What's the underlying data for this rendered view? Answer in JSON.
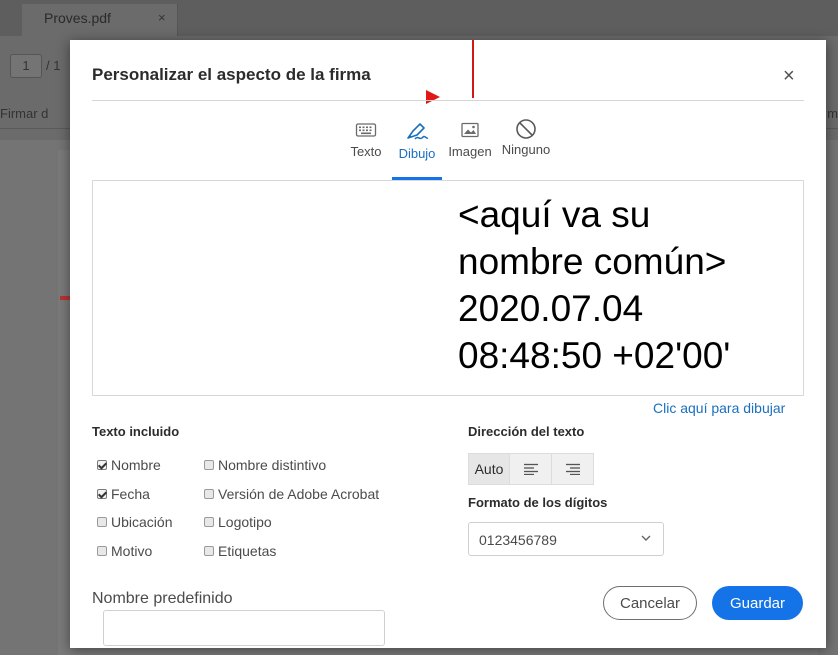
{
  "background": {
    "tab_label": "Proves.pdf",
    "tab_close": "×",
    "page_number": "1",
    "page_total": "/ 1",
    "sign_label": "Firmar d",
    "right_edge": "m"
  },
  "dialog": {
    "title": "Personalizar el aspecto de la firma",
    "close": "×"
  },
  "modes": {
    "items": [
      {
        "label": "Texto",
        "icon": "keyboard-icon"
      },
      {
        "label": "Dibujo",
        "icon": "pen-icon",
        "active": true
      },
      {
        "label": "Imagen",
        "icon": "image-icon"
      },
      {
        "label": "Ninguno",
        "icon": "none-icon"
      }
    ]
  },
  "preview": {
    "line1": "<aquí va su",
    "line2": "nombre común>",
    "line3": "2020.07.04",
    "line4": "08:48:50 +02'00'"
  },
  "draw_link": "Clic aquí para dibujar",
  "included": {
    "heading": "Texto incluido",
    "options": [
      {
        "label": "Nombre",
        "checked": true
      },
      {
        "label": "Fecha",
        "checked": true
      },
      {
        "label": "Ubicación",
        "checked": false
      },
      {
        "label": "Motivo",
        "checked": false
      },
      {
        "label": "Nombre distintivo",
        "checked": false
      },
      {
        "label": "Versión de Adobe Acrobat",
        "checked": false
      },
      {
        "label": "Logotipo",
        "checked": false
      },
      {
        "label": "Etiquetas",
        "checked": false
      }
    ]
  },
  "direction": {
    "heading": "Dirección del texto",
    "auto_label": "Auto",
    "options": [
      "Auto",
      "align-left-icon",
      "align-right-icon"
    ]
  },
  "digits": {
    "heading": "Formato de los dígitos",
    "value": "0123456789"
  },
  "predefined": {
    "label": "Nombre predefinido",
    "value": ""
  },
  "buttons": {
    "cancel": "Cancelar",
    "save": "Guardar"
  },
  "colors": {
    "accent": "#1473e6",
    "link": "#1a6fbf",
    "annotation_red": "#e01818"
  }
}
